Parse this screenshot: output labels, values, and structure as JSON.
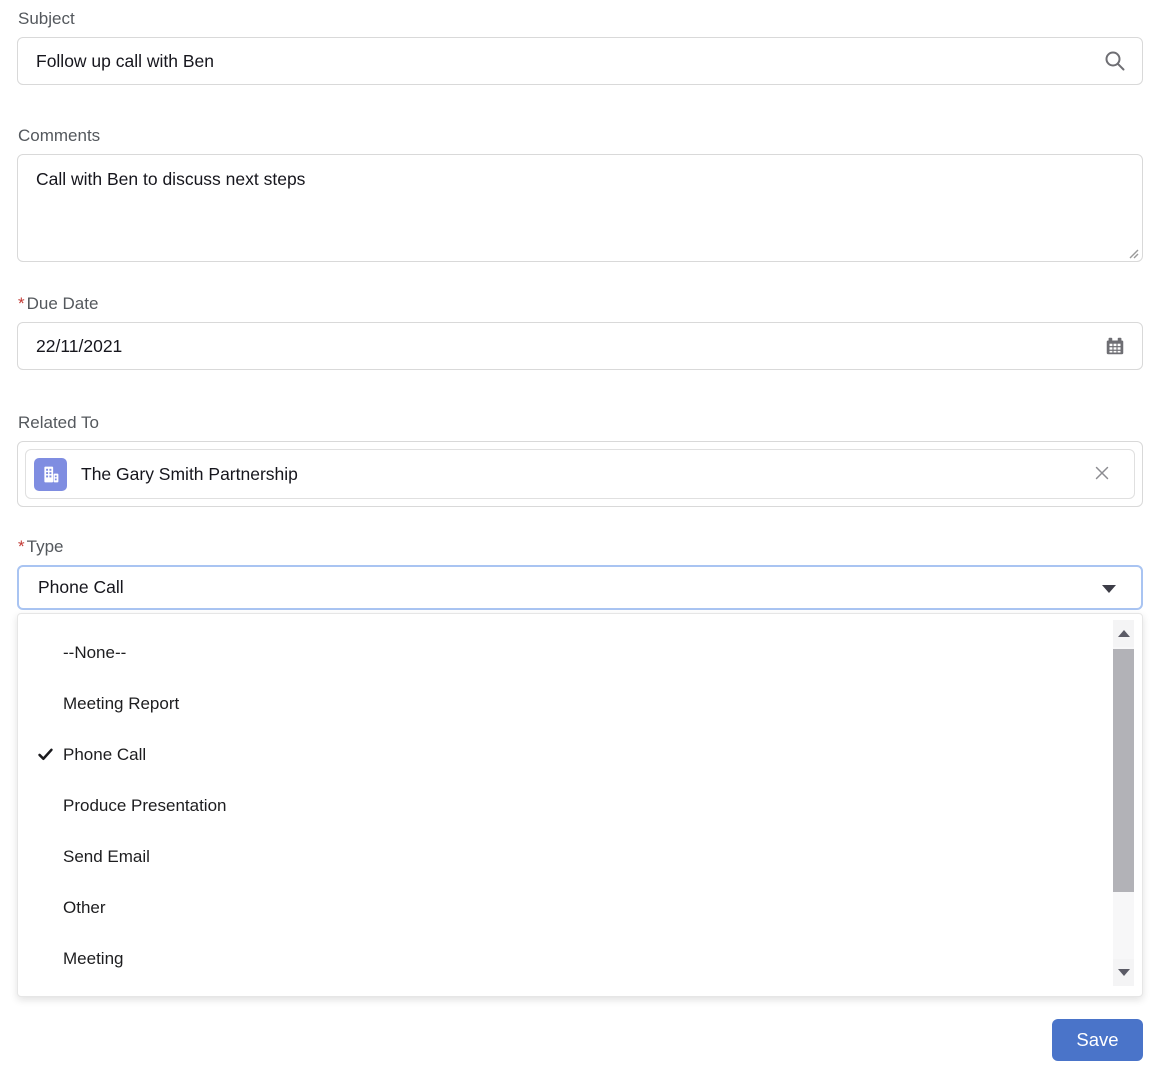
{
  "form": {
    "subject": {
      "label": "Subject",
      "value": "Follow up call with Ben"
    },
    "comments": {
      "label": "Comments",
      "value": "Call with Ben to discuss next steps"
    },
    "due_date": {
      "label": "Due Date",
      "required_marker": "*",
      "value": "22/11/2021"
    },
    "related_to": {
      "label": "Related To",
      "record_name": "The Gary Smith Partnership"
    },
    "type": {
      "label": "Type",
      "required_marker": "*",
      "selected_value": "Phone Call",
      "options": [
        {
          "label": "--None--",
          "selected": false
        },
        {
          "label": "Meeting Report",
          "selected": false
        },
        {
          "label": "Phone Call",
          "selected": true
        },
        {
          "label": "Produce Presentation",
          "selected": false
        },
        {
          "label": "Send Email",
          "selected": false
        },
        {
          "label": "Other",
          "selected": false
        },
        {
          "label": "Meeting",
          "selected": false
        }
      ]
    },
    "save_label": "Save"
  },
  "icons": {
    "subject_field": "search-icon",
    "due_date_field": "calendar-icon",
    "related_to_record": "account-building-icon",
    "related_to_remove": "close-icon",
    "type_field": "chevron-down-icon",
    "selected_option": "check-icon",
    "comments_field": "resize-handle-icon"
  },
  "colors": {
    "save_button": "#4a74c9",
    "required_asterisk": "#c23934",
    "account_icon_bg": "#7f8de1",
    "focus_border": "#a9c4f2",
    "input_border": "#d9d9d9",
    "label_text": "#54585d",
    "scrollbar_thumb": "#b2b2b7"
  }
}
